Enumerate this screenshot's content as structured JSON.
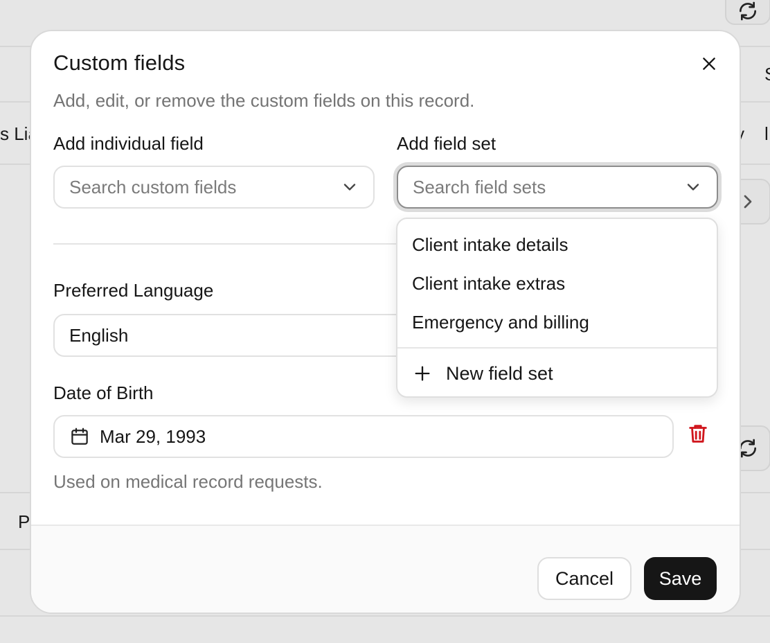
{
  "background": {
    "partial_texts": [
      "s Lia",
      "P",
      "S",
      "l",
      "y"
    ]
  },
  "modal": {
    "title": "Custom fields",
    "subtitle": "Add, edit, or remove the custom fields on this record.",
    "add_individual": {
      "label": "Add individual field",
      "placeholder": "Search custom fields"
    },
    "add_field_set": {
      "label": "Add field set",
      "placeholder": "Search field sets",
      "options": [
        "Client intake details",
        "Client intake extras",
        "Emergency and billing"
      ],
      "new_label": "New field set"
    },
    "fields": {
      "preferred_language": {
        "label": "Preferred Language",
        "value": "English"
      },
      "date_of_birth": {
        "label": "Date of Birth",
        "value": "Mar 29, 1993",
        "help": "Used on medical record requests."
      }
    },
    "footer": {
      "cancel": "Cancel",
      "save": "Save"
    }
  },
  "colors": {
    "primary": "#161616",
    "danger": "#d0151c",
    "muted": "#747474",
    "backdrop": "#e6e6e6"
  },
  "icons": [
    "refresh-icon",
    "chevron-right-icon",
    "close-icon",
    "chevron-down-icon",
    "calendar-icon",
    "trash-icon",
    "plus-icon"
  ]
}
